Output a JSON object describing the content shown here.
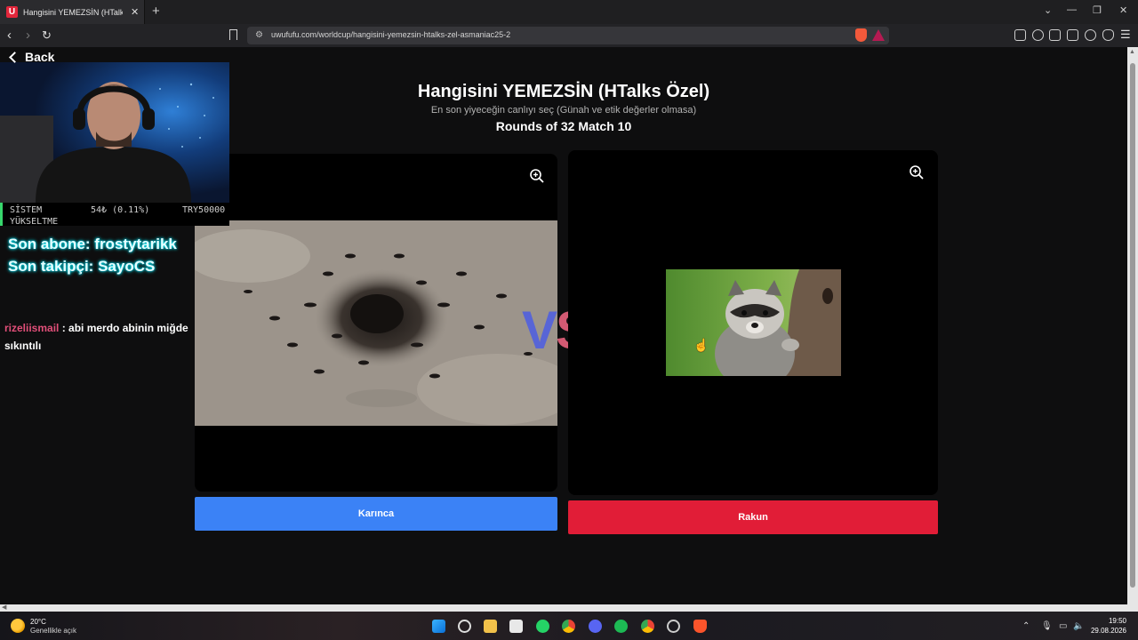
{
  "browser": {
    "tab_title": "Hangisini YEMEZSİN (HTalks Öz",
    "tab_favicon": "U",
    "url": "uwufufu.com/worldcup/hangisini-yemezsin-htalks-zel-asmaniac25-2"
  },
  "page": {
    "back_label": "Back",
    "title": "Hangisini YEMEZSİN (HTalks Özel)",
    "subtitle": "En son yiyeceğin canlıyı seç (Günah ve etik değerler olmasa)",
    "round_info": "Rounds of 32 Match 10",
    "vs_v": "V",
    "vs_s": "S",
    "left_choice": "Karınca",
    "right_choice": "Rakun"
  },
  "overlay": {
    "ticker_left": "SİSTEM",
    "ticker_mid": "54₺ (0.11%)",
    "ticker_right": "TRY50000",
    "ticker_sub": "YÜKSELTME",
    "last_subscriber": "Son abone: frostytarikk",
    "last_follower": "Son takipçi: SayoCS",
    "chat_user": "rizeliismail",
    "chat_message": " : abi merdo abinin miğde sıkıntılı"
  },
  "taskbar": {
    "temperature": "20°C",
    "weather": "Genellikle açık",
    "time": "19:50",
    "date": "29.08.2026"
  },
  "colors": {
    "left_button": "#3b82f6",
    "right_button": "#e11d37",
    "vs_v": "#5865d6",
    "vs_s": "#d25a73",
    "overlay_glow": "#00ffff",
    "chat_user": "#e14f79"
  }
}
